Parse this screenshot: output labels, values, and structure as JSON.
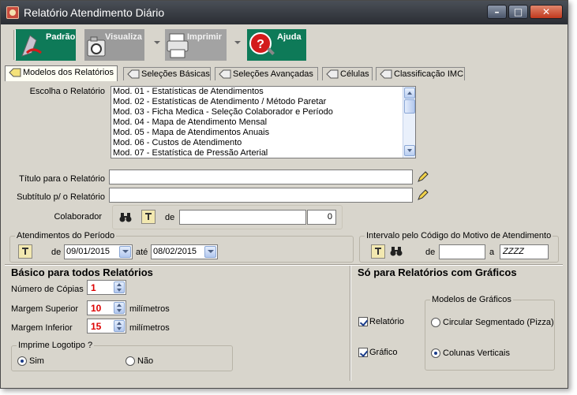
{
  "window": {
    "title": "Relatório Atendimento Diário"
  },
  "toolbar": {
    "padrao": "Padrão",
    "visualiza": "Visualiza",
    "imprimir": "Imprimir",
    "ajuda": "Ajuda"
  },
  "tabs": [
    {
      "label": "Modelos dos Relatórios",
      "active": true
    },
    {
      "label": "Seleções Básicas"
    },
    {
      "label": "Seleções Avançadas"
    },
    {
      "label": "Células"
    },
    {
      "label": "Classificação IMC"
    }
  ],
  "models": {
    "label": "Escolha o Relatório",
    "items": [
      "Mod. 01 - Estatísticas de Atendimentos",
      "Mod. 02 - Estatísticas de Atendimento / Método Paretar",
      "Mod. 03 - Ficha Medica - Seleção Colaborador e Período",
      "Mod. 04 - Mapa de Atendimento Mensal",
      "Mod. 05 - Mapa de Atendimentos Anuais",
      "Mod. 06 - Custos de Atendimento",
      "Mod. 07 - Estatística de Pressão Arterial"
    ]
  },
  "fields": {
    "titulo_label": "Título para o Relatório",
    "subtitulo_label": "Subtítulo  p/ o Relatório",
    "colaborador_label": "Colaborador",
    "de_label": "de",
    "colaborador_count": "0"
  },
  "periodo": {
    "title": "Atendimentos do Período",
    "de_label": "de",
    "from": "09/01/2015",
    "ate_label": "até",
    "to": "08/02/2015"
  },
  "intervalo": {
    "title": "Intervalo pelo Código do Motivo de Atendimento",
    "de_label": "de",
    "a_label": "a",
    "to_value": "ZZZZ"
  },
  "basico": {
    "title": "Básico para todos Relatórios",
    "copias_label": "Número de Cópias",
    "copias": "1",
    "margem_sup_label": "Margem Superior",
    "margem_sup": "10",
    "margem_inf_label": "Margem Inferior",
    "margem_inf": "15",
    "unit": "milímetros",
    "logotipo_title": "Imprime Logotipo ?",
    "sim": "Sim",
    "nao": "Não"
  },
  "graficos": {
    "title": "Só para Relatórios com Gráficos",
    "relatorio": "Relatório",
    "grafico": "Gráfico",
    "modelos_title": "Modelos de Gráficos",
    "pizza": "Circular Segmentado (Pizza)",
    "colunas": "Colunas Verticais"
  },
  "colors": {
    "accent": "#0e7a58",
    "value_red": "#dd0000"
  }
}
